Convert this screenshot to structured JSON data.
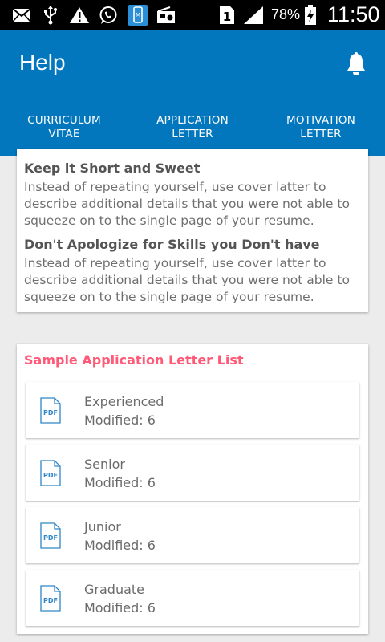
{
  "status_bar": {
    "battery": "78%",
    "time": "11:50",
    "sim_badge": "1",
    "icons": [
      "email-icon",
      "usb-icon",
      "warning-icon",
      "whatsapp-icon",
      "app-notification-icon",
      "radio-icon",
      "sim-icon",
      "signal-icon",
      "battery-charging-icon"
    ]
  },
  "app_bar": {
    "title": "Help",
    "icon": "bell-icon",
    "color": "#0277bd"
  },
  "tabs": [
    {
      "line1": "CURRICULUM",
      "line2": "VITAE",
      "selected": false
    },
    {
      "line1": "APPLICATION",
      "line2": "LETTER",
      "selected": true
    },
    {
      "line1": "MOTIVATION",
      "line2": "LETTER",
      "selected": false
    }
  ],
  "tips": [
    {
      "title": "Keep it Short and Sweet",
      "lines": [
        "Instead of repeating yourself, use cover latter to",
        "describe additional details that you were not able to",
        "squeeze on to the single page of your resume."
      ]
    },
    {
      "title": "Don't Apologize for Skills you Don't have",
      "lines": [
        "Instead of repeating yourself, use cover latter to",
        "describe additional details that you were not able to",
        "squeeze on to the single page of your resume."
      ]
    }
  ],
  "sample_list": {
    "heading": "Sample Application Letter List",
    "heading_color": "#ff5a78",
    "icon": "pdf-file-icon",
    "icon_label": "PDF",
    "items": [
      {
        "name": "Experienced",
        "modified": "Modified: 6"
      },
      {
        "name": "Senior",
        "modified": "Modified: 6"
      },
      {
        "name": "Junior",
        "modified": "Modified: 6"
      },
      {
        "name": "Graduate",
        "modified": "Modified: 6"
      }
    ]
  }
}
